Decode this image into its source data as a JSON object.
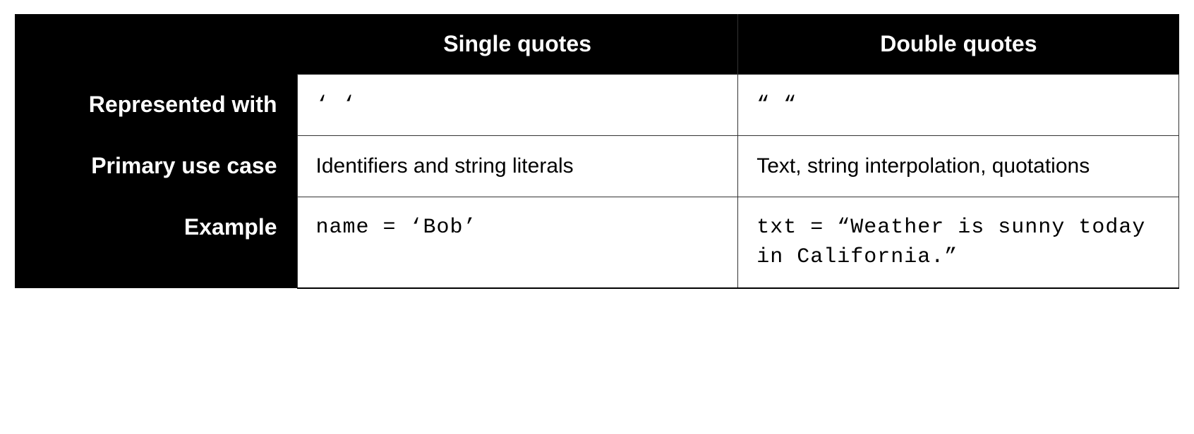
{
  "table": {
    "columns": [
      "Single quotes",
      "Double quotes"
    ],
    "rows": [
      {
        "label": "Represented with",
        "single": "‘ ‘",
        "double": "“ “",
        "mono": true
      },
      {
        "label": "Primary use case",
        "single": "Identifiers and string literals",
        "double": "Text, string interpolation, quotations",
        "mono": false
      },
      {
        "label": "Example",
        "single": "name = ‘Bob’",
        "double": "txt = “Weather is sunny today in California.”",
        "mono": true
      }
    ]
  }
}
